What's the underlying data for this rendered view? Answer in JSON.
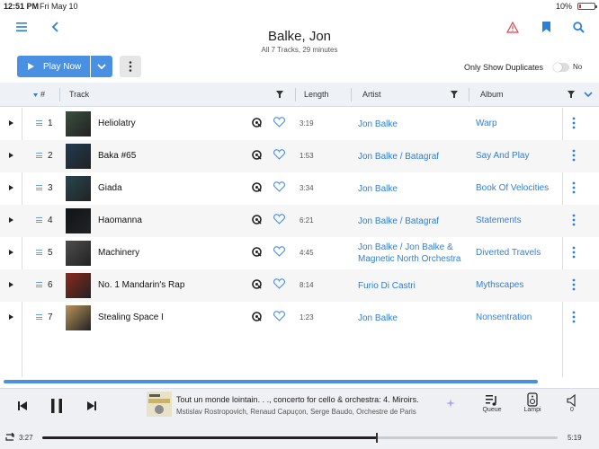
{
  "status_bar": {
    "time": "12:51 PM",
    "date": "Fri May 10",
    "battery": "10%"
  },
  "header": {
    "title": "Balke, Jon",
    "subtitle": "All 7 Tracks, 29 minutes",
    "icons": [
      "menu-icon",
      "back-icon",
      "warning-icon",
      "bookmark-icon",
      "search-icon"
    ]
  },
  "toolbar": {
    "play_label": "Play Now",
    "duplicates_label": "Only Show Duplicates",
    "toggle_state": "No"
  },
  "table": {
    "columns": {
      "num": "#",
      "track": "Track",
      "length": "Length",
      "artist": "Artist",
      "album": "Album"
    },
    "rows": [
      {
        "num": "1",
        "track": "Heliolatry",
        "length": "3:19",
        "artist": "Jon Balke",
        "album": "Warp",
        "art_color": "#3b4f40"
      },
      {
        "num": "2",
        "track": "Baka #65",
        "length": "1:53",
        "artist": "Jon Balke / Batagraf",
        "album": "Say And Play",
        "art_color": "#1f3a52"
      },
      {
        "num": "3",
        "track": "Giada",
        "length": "3:34",
        "artist": "Jon Balke",
        "album": "Book Of Velocities",
        "art_color": "#27474e"
      },
      {
        "num": "4",
        "track": "Haomanna",
        "length": "6:21",
        "artist": "Jon Balke / Batagraf",
        "album": "Statements",
        "art_color": "#101418"
      },
      {
        "num": "5",
        "track": "Machinery",
        "length": "4:45",
        "artist": "Jon Balke / Jon Balke & Magnetic North Orchestra",
        "album": "Diverted Travels",
        "art_color": "#4d4d4d"
      },
      {
        "num": "6",
        "track": "No. 1 Mandarin's Rap",
        "length": "8:14",
        "artist": "Furio Di Castri",
        "album": "Mythscapes",
        "art_color": "#8a2a1c"
      },
      {
        "num": "7",
        "track": "Stealing Space I",
        "length": "1:23",
        "artist": "Jon Balke",
        "album": "Nonsentration",
        "art_color": "#b8955a"
      }
    ]
  },
  "player": {
    "now_playing_title": "Tout un monde lointain. . ., concerto for cello & orchestra: 4. Miroirs.",
    "now_playing_artists": "Mstislav Rostropovich, Renaud Capuçon, Serge Baudo, Orchestre de Paris",
    "queue_label": "Queue",
    "zone_label": "Lampi",
    "volume_label": "0",
    "current_time": "3:27",
    "total_time": "5:19",
    "progress": 0.65
  },
  "colors": {
    "accent": "#4a90e2",
    "link": "#2f7fd8",
    "warning": "#e0424e"
  }
}
